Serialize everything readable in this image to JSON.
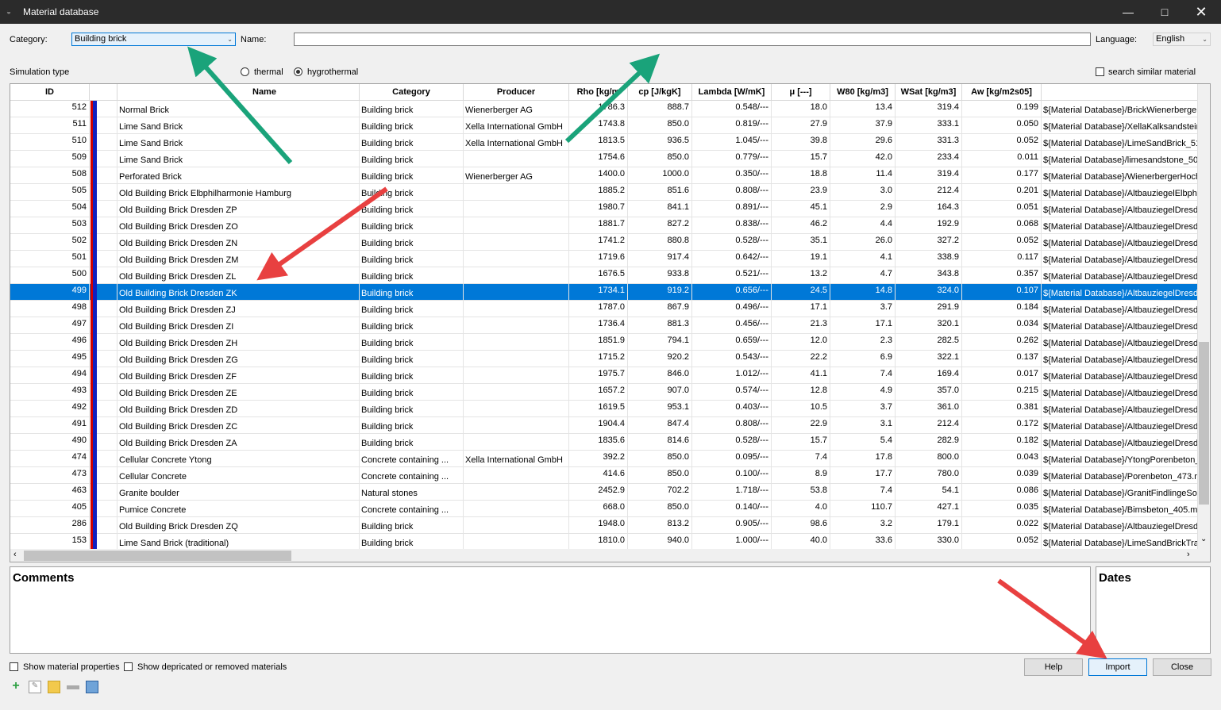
{
  "window": {
    "title": "Material database",
    "icon": "app-icon",
    "controls": [
      "minimize-icon",
      "maximize-icon",
      "close-icon"
    ]
  },
  "filters": {
    "category_label": "Category:",
    "category_value": "Building brick",
    "name_label": "Name:",
    "name_value": "",
    "language_label": "Language:",
    "language_value": "English",
    "simulation_type_label": "Simulation type",
    "sim_thermal": "thermal",
    "sim_hygrothermal": "hygrothermal",
    "sim_selected": "hygrothermal",
    "search_similar": "search similar material"
  },
  "table": {
    "columns": [
      "ID",
      "",
      "Name",
      "Category",
      "Producer",
      "Rho [kg/m3]",
      "cp [J/kgK]",
      "Lambda [W/mK]",
      "μ [---]",
      "W80 [kg/m3]",
      "WSat [kg/m3]",
      "Aw [kg/m2s05]",
      ""
    ],
    "header_visible": [
      "ID",
      "Name",
      "Category",
      "Producer",
      "Rho [kg/m",
      "cp [J/kgK]",
      "Lambda [W/mK]",
      "μ [---]",
      "W80 [kg/m3]",
      "WSat [kg/m3]",
      "Aw [kg/m2s05]"
    ],
    "selected_id": "499",
    "rows": [
      [
        "512",
        "Normal Brick",
        "Building brick",
        "Wienerberger AG",
        "1786.3",
        "888.7",
        "0.548/---",
        "18.0",
        "13.4",
        "319.4",
        "0.199",
        "${Material Database}/BrickWienerberger"
      ],
      [
        "511",
        "Lime Sand Brick",
        "Building brick",
        "Xella International GmbH",
        "1743.8",
        "850.0",
        "0.819/---",
        "27.9",
        "37.9",
        "333.1",
        "0.050",
        "${Material Database}/XellaKalksandstein_"
      ],
      [
        "510",
        "Lime Sand Brick",
        "Building brick",
        "Xella International GmbH",
        "1813.5",
        "936.5",
        "1.045/---",
        "39.8",
        "29.6",
        "331.3",
        "0.052",
        "${Material Database}/LimeSandBrick_51("
      ],
      [
        "509",
        "Lime Sand Brick",
        "Building brick",
        "",
        "1754.6",
        "850.0",
        "0.779/---",
        "15.7",
        "42.0",
        "233.4",
        "0.011",
        "${Material Database}/limesandstone_509"
      ],
      [
        "508",
        "Perforated Brick",
        "Building brick",
        "Wienerberger AG",
        "1400.0",
        "1000.0",
        "0.350/---",
        "18.8",
        "11.4",
        "319.4",
        "0.177",
        "${Material Database}/WienerbergerHoch"
      ],
      [
        "505",
        "Old Building Brick Elbphilharmonie Hamburg",
        "Building brick",
        "",
        "1885.2",
        "851.6",
        "0.808/---",
        "23.9",
        "3.0",
        "212.4",
        "0.201",
        "${Material Database}/AltbauziegelElbphil"
      ],
      [
        "504",
        "Old Building Brick Dresden ZP",
        "Building brick",
        "",
        "1980.7",
        "841.1",
        "0.891/---",
        "45.1",
        "2.9",
        "164.3",
        "0.051",
        "${Material Database}/AltbauziegelDresde"
      ],
      [
        "503",
        "Old Building Brick Dresden ZO",
        "Building brick",
        "",
        "1881.7",
        "827.2",
        "0.838/---",
        "46.2",
        "4.4",
        "192.9",
        "0.068",
        "${Material Database}/AltbauziegelDresde"
      ],
      [
        "502",
        "Old Building Brick Dresden ZN",
        "Building brick",
        "",
        "1741.2",
        "880.8",
        "0.528/---",
        "35.1",
        "26.0",
        "327.2",
        "0.052",
        "${Material Database}/AltbauziegelDresde"
      ],
      [
        "501",
        "Old Building Brick Dresden ZM",
        "Building brick",
        "",
        "1719.6",
        "917.4",
        "0.642/---",
        "19.1",
        "4.1",
        "338.9",
        "0.117",
        "${Material Database}/AltbauziegelDresde"
      ],
      [
        "500",
        "Old Building Brick Dresden ZL",
        "Building brick",
        "",
        "1676.5",
        "933.8",
        "0.521/---",
        "13.2",
        "4.7",
        "343.8",
        "0.357",
        "${Material Database}/AltbauziegelDresde"
      ],
      [
        "499",
        "Old Building Brick Dresden ZK",
        "Building brick",
        "",
        "1734.1",
        "919.2",
        "0.656/---",
        "24.5",
        "14.8",
        "324.0",
        "0.107",
        "${Material Database}/AltbauziegelDresde"
      ],
      [
        "498",
        "Old Building Brick Dresden ZJ",
        "Building brick",
        "",
        "1787.0",
        "867.9",
        "0.496/---",
        "17.1",
        "3.7",
        "291.9",
        "0.184",
        "${Material Database}/AltbauziegelDresde"
      ],
      [
        "497",
        "Old Building Brick Dresden ZI",
        "Building brick",
        "",
        "1736.4",
        "881.3",
        "0.456/---",
        "21.3",
        "17.1",
        "320.1",
        "0.034",
        "${Material Database}/AltbauziegelDresde"
      ],
      [
        "496",
        "Old Building Brick Dresden ZH",
        "Building brick",
        "",
        "1851.9",
        "794.1",
        "0.659/---",
        "12.0",
        "2.3",
        "282.5",
        "0.262",
        "${Material Database}/AltbauziegelDresde"
      ],
      [
        "495",
        "Old Building Brick Dresden ZG",
        "Building brick",
        "",
        "1715.2",
        "920.2",
        "0.543/---",
        "22.2",
        "6.9",
        "322.1",
        "0.137",
        "${Material Database}/AltbauziegelDresde"
      ],
      [
        "494",
        "Old Building Brick Dresden ZF",
        "Building brick",
        "",
        "1975.7",
        "846.0",
        "1.012/---",
        "41.1",
        "7.4",
        "169.4",
        "0.017",
        "${Material Database}/AltbauziegelDresde"
      ],
      [
        "493",
        "Old Building Brick Dresden ZE",
        "Building brick",
        "",
        "1657.2",
        "907.0",
        "0.574/---",
        "12.8",
        "4.9",
        "357.0",
        "0.215",
        "${Material Database}/AltbauziegelDresde"
      ],
      [
        "492",
        "Old Building Brick Dresden ZD",
        "Building brick",
        "",
        "1619.5",
        "953.1",
        "0.403/---",
        "10.5",
        "3.7",
        "361.0",
        "0.381",
        "${Material Database}/AltbauziegelDresde"
      ],
      [
        "491",
        "Old Building Brick Dresden ZC",
        "Building brick",
        "",
        "1904.4",
        "847.4",
        "0.808/---",
        "22.9",
        "3.1",
        "212.4",
        "0.172",
        "${Material Database}/AltbauziegelDresde"
      ],
      [
        "490",
        "Old Building Brick Dresden ZA",
        "Building brick",
        "",
        "1835.6",
        "814.6",
        "0.528/---",
        "15.7",
        "5.4",
        "282.9",
        "0.182",
        "${Material Database}/AltbauziegelDresde"
      ],
      [
        "474",
        "Cellular Concrete Ytong",
        "Concrete containing ...",
        "Xella International GmbH",
        "392.2",
        "850.0",
        "0.095/---",
        "7.4",
        "17.8",
        "800.0",
        "0.043",
        "${Material Database}/YtongPorenbeton_"
      ],
      [
        "473",
        "Cellular Concrete",
        "Concrete containing ...",
        "",
        "414.6",
        "850.0",
        "0.100/---",
        "8.9",
        "17.7",
        "780.0",
        "0.039",
        "${Material Database}/Porenbeton_473.m"
      ],
      [
        "463",
        "Granite boulder",
        "Natural stones",
        "",
        "2452.9",
        "702.2",
        "1.718/---",
        "53.8",
        "7.4",
        "54.1",
        "0.086",
        "${Material Database}/GranitFindlingeSoc"
      ],
      [
        "405",
        "Pumice Concrete",
        "Concrete containing ...",
        "",
        "668.0",
        "850.0",
        "0.140/---",
        "4.0",
        "110.7",
        "427.1",
        "0.035",
        "${Material Database}/Bimsbeton_405.m6"
      ],
      [
        "286",
        "Old Building Brick Dresden ZQ",
        "Building brick",
        "",
        "1948.0",
        "813.2",
        "0.905/---",
        "98.6",
        "3.2",
        "179.1",
        "0.022",
        "${Material Database}/AltbauziegelDresde"
      ],
      [
        "153",
        "Lime Sand Brick (traditional)",
        "Building brick",
        "",
        "1810.0",
        "940.0",
        "1.000/---",
        "40.0",
        "33.6",
        "330.0",
        "0.052",
        "${Material Database}/LimeSandBrickTrac"
      ]
    ]
  },
  "panels": {
    "comments": "Comments",
    "dates": "Dates"
  },
  "footer": {
    "show_props": "Show material properties",
    "show_deprecated": "Show depricated or removed materials",
    "help": "Help",
    "import": "Import",
    "close": "Close",
    "toolbar_icons": [
      "add-icon",
      "edit-icon",
      "copy-icon",
      "remove-icon",
      "database-icon"
    ]
  },
  "annotations": {
    "arrow_colors": {
      "green": "#1aa37a",
      "red": "#e84040"
    }
  }
}
